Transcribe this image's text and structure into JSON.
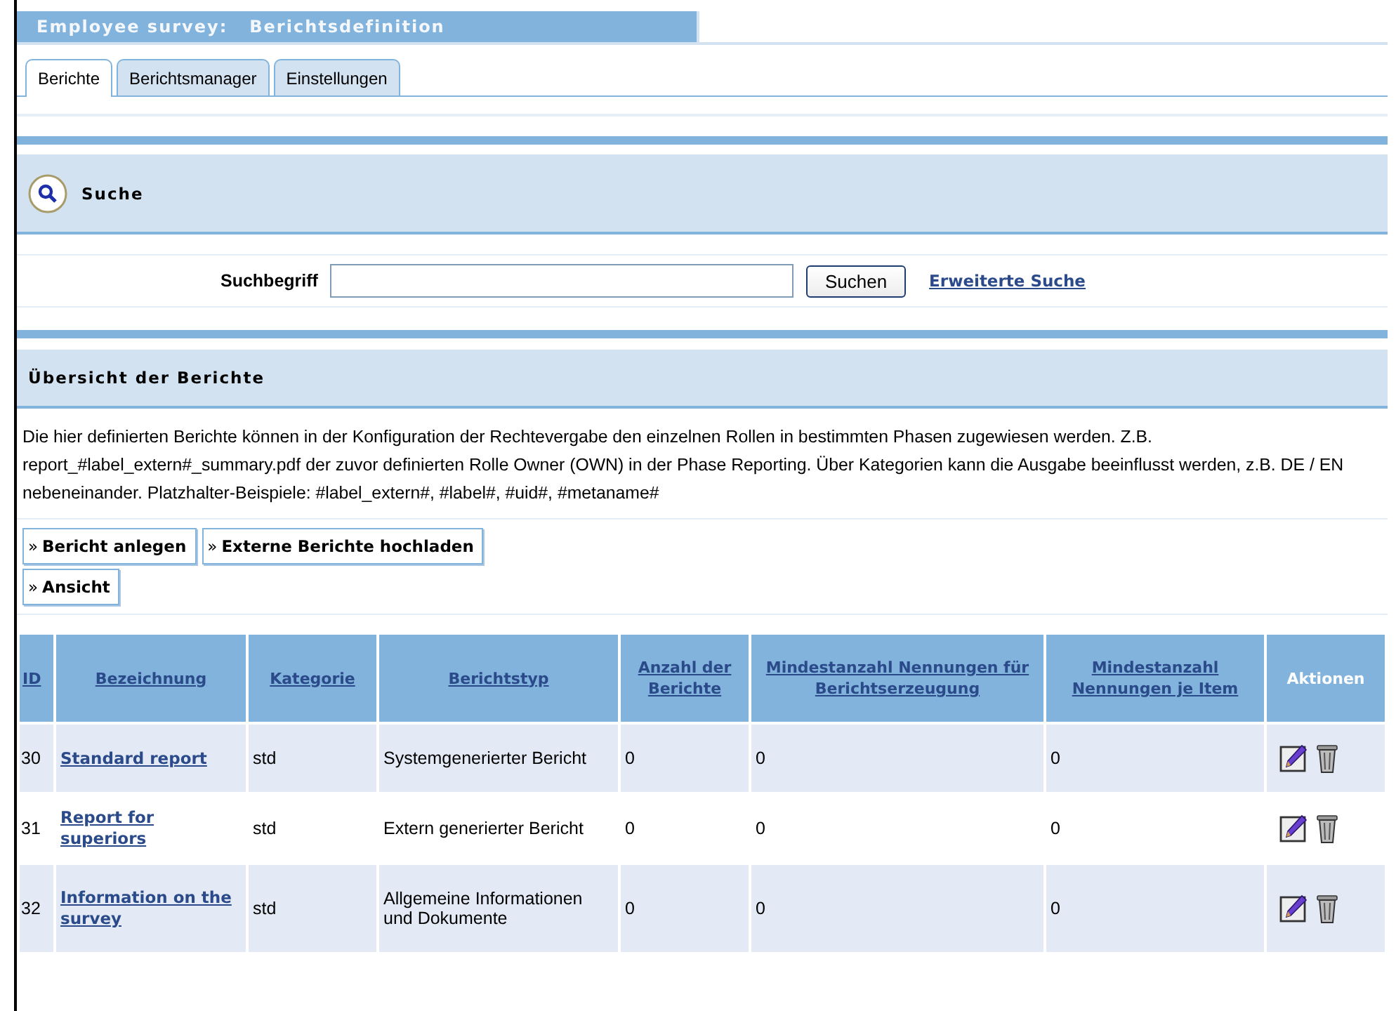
{
  "window": {
    "title": "Employee survey:",
    "subtitle": "Berichtsdefinition"
  },
  "tabs": [
    {
      "label": "Berichte",
      "selected": true
    },
    {
      "label": "Berichtsmanager",
      "selected": false
    },
    {
      "label": "Einstellungen",
      "selected": false
    }
  ],
  "search_section": {
    "title": "Suche",
    "field_label": "Suchbegriff",
    "search_button": "Suchen",
    "advanced_link": "Erweiterte Suche"
  },
  "overview": {
    "title": "Übersicht der Berichte",
    "description": "Die hier definierten Berichte können in der Konfiguration der Rechtevergabe den einzelnen Rollen in bestimmten Phasen zugewiesen werden. Z.B. report_#label_extern#_summary.pdf der zuvor definierten Rolle Owner (OWN) in der Phase Reporting. Über Kategorien kann die Ausgabe beeinflusst werden, z.B. DE / EN nebeneinander. Platzhalter-Beispiele: #label_extern#, #label#, #uid#, #metaname#",
    "buttons": [
      [
        "»",
        "Bericht anlegen"
      ],
      [
        "»",
        "Externe Berichte hochladen"
      ]
    ],
    "view_button": [
      "»",
      "Ansicht"
    ]
  },
  "table": {
    "columns": [
      {
        "label": "ID",
        "sortable": true
      },
      {
        "label": "Bezeichnung",
        "sortable": true
      },
      {
        "label": "Kategorie",
        "sortable": true
      },
      {
        "label": "Berichtstyp",
        "sortable": true
      },
      {
        "label": "Anzahl der Berichte",
        "sortable": true
      },
      {
        "label": "Mindestanzahl Nennungen für Berichtserzeugung",
        "sortable": true
      },
      {
        "label": "Mindestanzahl Nennungen je Item",
        "sortable": true
      },
      {
        "label": "Aktionen",
        "sortable": false
      }
    ],
    "rows": [
      {
        "id": "30",
        "name": "Standard report",
        "category": "std",
        "type": "Systemgenerierter Bericht",
        "count": "0",
        "min_report": "0",
        "min_item": "0"
      },
      {
        "id": "31",
        "name": "Report for superiors",
        "category": "std",
        "type": "Extern generierter Bericht",
        "count": "0",
        "min_report": "0",
        "min_item": "0"
      },
      {
        "id": "32",
        "name": "Information on the survey",
        "category": "std",
        "type": "Allgemeine Informationen und Dokumente",
        "count": "0",
        "min_report": "0",
        "min_item": "0"
      }
    ]
  }
}
